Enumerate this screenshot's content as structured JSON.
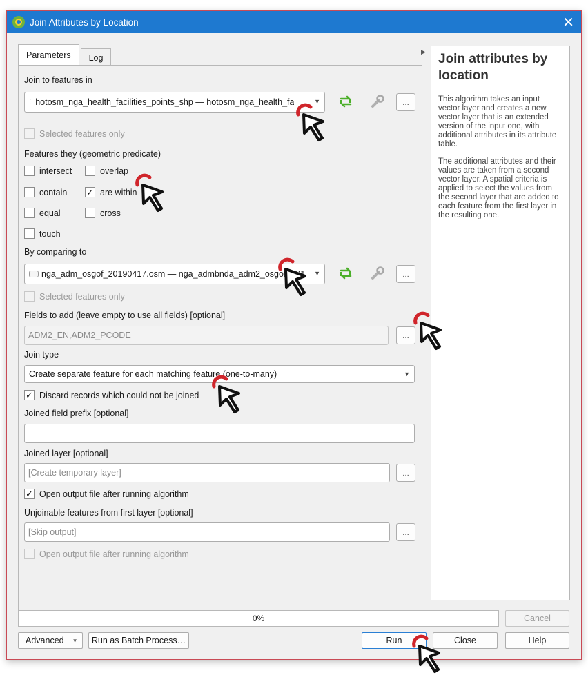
{
  "dialog": {
    "title": "Join Attributes by Location",
    "close_glyph": "✕"
  },
  "tabs": [
    {
      "label": "Parameters"
    },
    {
      "label": "Log"
    }
  ],
  "join_to": {
    "label": "Join to features in",
    "value": "hotosm_nga_health_facilities_points_shp — hotosm_nga_health_fa",
    "selected_only": "Selected features only"
  },
  "predicate": {
    "label": "Features they (geometric predicate)",
    "options": [
      {
        "label": "intersect",
        "checked": false
      },
      {
        "label": "overlap",
        "checked": false
      },
      {
        "label": "contain",
        "checked": false
      },
      {
        "label": "are within",
        "checked": true
      },
      {
        "label": "equal",
        "checked": false
      },
      {
        "label": "cross",
        "checked": false
      },
      {
        "label": "touch",
        "checked": false
      }
    ]
  },
  "compare": {
    "label": "By comparing to",
    "value": "nga_adm_osgof_20190417.osm — nga_admbnda_adm2_osgof_201",
    "selected_only": "Selected features only"
  },
  "fields": {
    "label": "Fields to add (leave empty to use all fields) [optional]",
    "value": "ADM2_EN,ADM2_PCODE"
  },
  "join_type": {
    "label": "Join type",
    "value": "Create separate feature for each matching feature (one-to-many)"
  },
  "discard": {
    "label": "Discard records which could not be joined",
    "checked": true
  },
  "prefix": {
    "label": "Joined field prefix [optional]",
    "value": ""
  },
  "joined_layer": {
    "label": "Joined layer [optional]",
    "placeholder": "[Create temporary layer]",
    "open_after": "Open output file after running algorithm"
  },
  "unjoinable": {
    "label": "Unjoinable features from first layer [optional]",
    "placeholder": "[Skip output]",
    "open_after": "Open output file after running algorithm"
  },
  "browse_label": "…",
  "help": {
    "title": "Join attributes by location",
    "paragraphs": [
      "This algorithm takes an input vector layer and creates a new vector layer that is an extended version of the input one, with additional attributes in its attribute table.",
      "The additional attributes and their values are taken from a second vector layer. A spatial criteria is applied to select the values from the second layer that are added to each feature from the first layer in the resulting one."
    ]
  },
  "progress": {
    "value": 0,
    "text": "0%"
  },
  "buttons": {
    "cancel": "Cancel",
    "advanced": "Advanced",
    "batch": "Run as Batch Process…",
    "run": "Run",
    "close": "Close",
    "help": "Help"
  },
  "colors": {
    "titlebar": "#1e79d0",
    "cursor_ring": "#d0252b",
    "accent_green": "#4caf2a"
  }
}
